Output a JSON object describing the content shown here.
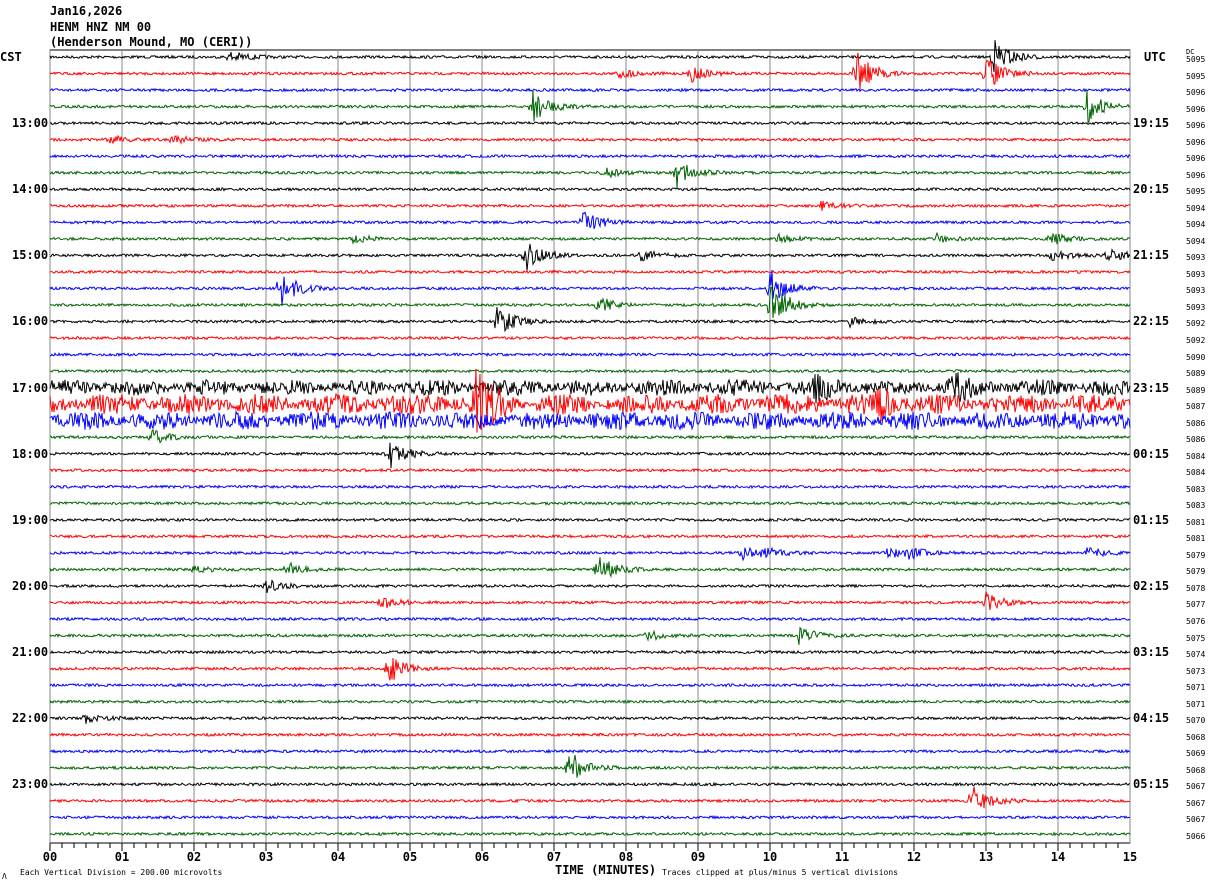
{
  "header": {
    "date": "Jan16,2026",
    "station": "HENM HNZ NM 00",
    "location": "(Henderson Mound, MO (CERI))"
  },
  "left_tz": "CST",
  "right_tz": "UTC",
  "dc_label": "DC",
  "left_labels": [
    "13:00",
    "14:00",
    "15:00",
    "16:00",
    "17:00",
    "18:00",
    "19:00",
    "20:00",
    "21:00",
    "22:00",
    "23:00"
  ],
  "right_labels": [
    "19:15",
    "20:15",
    "21:15",
    "22:15",
    "23:15",
    "00:15",
    "01:15",
    "02:15",
    "03:15",
    "04:15",
    "05:15"
  ],
  "dc_values": [
    "5095",
    "5095",
    "5096",
    "5096",
    "5096",
    "5096",
    "5096",
    "5096",
    "5095",
    "5094",
    "5094",
    "5094",
    "5093",
    "5093",
    "5093",
    "5093",
    "5092",
    "5092",
    "5090",
    "5089",
    "5089",
    "5087",
    "5086",
    "5086",
    "5084",
    "5084",
    "5083",
    "5083",
    "5081",
    "5081",
    "5079",
    "5079",
    "5078",
    "5077",
    "5076",
    "5075",
    "5074",
    "5073",
    "5071",
    "5071",
    "5070",
    "5068",
    "5069",
    "5068",
    "5067",
    "5067",
    "5067",
    "5066"
  ],
  "footer": {
    "scale": "Each Vertical Division =  200.00 microvolts",
    "xlabel": "TIME (MINUTES)",
    "clip": "Traces clipped at plus/minus 5 vertical divisions",
    "mark": "Λ"
  },
  "chart_data": {
    "type": "line",
    "title": "HENM HNZ NM 00 helicorder",
    "xlabel": "TIME (MINUTES)",
    "xlim": [
      0,
      15
    ],
    "x_ticks": [
      "00",
      "01",
      "02",
      "03",
      "04",
      "05",
      "06",
      "07",
      "08",
      "09",
      "10",
      "11",
      "12",
      "13",
      "14",
      "15"
    ],
    "rows": 48,
    "trace_colors": [
      "#000000",
      "#ff0000",
      "#0000ff",
      "#006400"
    ],
    "noisy_rows": {
      "20": 0.35,
      "21": 0.45,
      "22": 0.4
    },
    "events": [
      {
        "row": 0,
        "min": 2.5,
        "amp": 0.4
      },
      {
        "row": 0,
        "min": 13.1,
        "amp": 1.2
      },
      {
        "row": 1,
        "min": 11.2,
        "amp": 1.4
      },
      {
        "row": 1,
        "min": 13.0,
        "amp": 1.1
      },
      {
        "row": 1,
        "min": 8.9,
        "amp": 0.5
      },
      {
        "row": 1,
        "min": 7.9,
        "amp": 0.3
      },
      {
        "row": 3,
        "min": 6.7,
        "amp": 1.0
      },
      {
        "row": 3,
        "min": 14.4,
        "amp": 1.0
      },
      {
        "row": 5,
        "min": 0.8,
        "amp": 0.3
      },
      {
        "row": 5,
        "min": 1.7,
        "amp": 0.3
      },
      {
        "row": 7,
        "min": 8.7,
        "amp": 0.9
      },
      {
        "row": 7,
        "min": 7.7,
        "amp": 0.3
      },
      {
        "row": 9,
        "min": 10.7,
        "amp": 0.3
      },
      {
        "row": 10,
        "min": 7.4,
        "amp": 0.8
      },
      {
        "row": 11,
        "min": 4.2,
        "amp": 0.3
      },
      {
        "row": 11,
        "min": 10.1,
        "amp": 0.3
      },
      {
        "row": 11,
        "min": 12.3,
        "amp": 0.3
      },
      {
        "row": 11,
        "min": 13.9,
        "amp": 0.4
      },
      {
        "row": 12,
        "min": 6.6,
        "amp": 1.0
      },
      {
        "row": 12,
        "min": 8.2,
        "amp": 0.4
      },
      {
        "row": 12,
        "min": 13.9,
        "amp": 0.4
      },
      {
        "row": 12,
        "min": 14.7,
        "amp": 0.5
      },
      {
        "row": 14,
        "min": 3.2,
        "amp": 1.1
      },
      {
        "row": 14,
        "min": 10.0,
        "amp": 1.2
      },
      {
        "row": 15,
        "min": 7.6,
        "amp": 0.6
      },
      {
        "row": 15,
        "min": 10.0,
        "amp": 1.6
      },
      {
        "row": 16,
        "min": 6.2,
        "amp": 1.1
      },
      {
        "row": 16,
        "min": 11.1,
        "amp": 0.3
      },
      {
        "row": 20,
        "min": 10.6,
        "amp": 0.6
      },
      {
        "row": 20,
        "min": 12.5,
        "amp": 0.6
      },
      {
        "row": 21,
        "min": 5.9,
        "amp": 1.6
      },
      {
        "row": 21,
        "min": 11.5,
        "amp": 0.7
      },
      {
        "row": 23,
        "min": 1.4,
        "amp": 0.5
      },
      {
        "row": 24,
        "min": 4.7,
        "amp": 1.0
      },
      {
        "row": 30,
        "min": 9.6,
        "amp": 0.4
      },
      {
        "row": 30,
        "min": 9.9,
        "amp": 0.4
      },
      {
        "row": 30,
        "min": 11.6,
        "amp": 0.4
      },
      {
        "row": 30,
        "min": 11.9,
        "amp": 0.4
      },
      {
        "row": 30,
        "min": 14.4,
        "amp": 0.4
      },
      {
        "row": 31,
        "min": 7.6,
        "amp": 1.0
      },
      {
        "row": 31,
        "min": 3.3,
        "amp": 0.4
      },
      {
        "row": 31,
        "min": 2.0,
        "amp": 0.3
      },
      {
        "row": 32,
        "min": 3.0,
        "amp": 0.4
      },
      {
        "row": 33,
        "min": 4.6,
        "amp": 0.5
      },
      {
        "row": 33,
        "min": 13.0,
        "amp": 0.6
      },
      {
        "row": 35,
        "min": 10.4,
        "amp": 0.6
      },
      {
        "row": 35,
        "min": 8.3,
        "amp": 0.3
      },
      {
        "row": 37,
        "min": 4.7,
        "amp": 0.9
      },
      {
        "row": 40,
        "min": 0.5,
        "amp": 0.3
      },
      {
        "row": 43,
        "min": 7.2,
        "amp": 1.1
      },
      {
        "row": 45,
        "min": 12.8,
        "amp": 1.0
      }
    ]
  }
}
